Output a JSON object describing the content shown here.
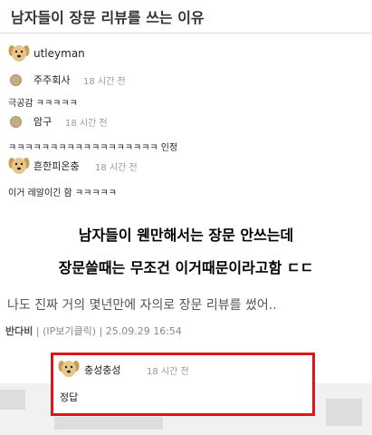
{
  "post": {
    "title": "남자들이 장문 리뷰를 쓰는 이유"
  },
  "comments": [
    {
      "user": "utleyman",
      "time": "",
      "text": ""
    },
    {
      "user": "주주회사",
      "time": "18 시간 전",
      "text": "극공감 ㅋㅋㅋㅋㅋ"
    },
    {
      "user": "암구",
      "time": "18 시간 전",
      "text": "ㅋㅋㅋㅋㅋㅋㅋㅋㅋㅋㅋㅋㅋㅋㅋㅋㅋㅋ 인정"
    },
    {
      "user": "흔한피온충",
      "time": "18 시간 전",
      "text": "이거 레알이긴 함 ㅋㅋㅋㅋㅋ"
    }
  ],
  "caption": {
    "line1": "남자들이 웬만해서는 장문 안쓰는데",
    "line2": "장문쓸때는 무조건 이거때문이라고함 ㄷㄷ"
  },
  "review": {
    "text": "나도 진짜 거의 몇년만에 자의로 장문 리뷰를 썼어..",
    "author": "반다비",
    "ip": "(IP보기클릭)",
    "date": "25.09.29 16:54"
  },
  "reply": {
    "user": "충성충성",
    "time": "18 시간 전",
    "text": "정답"
  },
  "colors": {
    "highlight": "#e0141c",
    "avatar": "#e7c68c"
  },
  "icons": {
    "dog": "dog-avatar-icon",
    "dot": "user-dot-icon"
  }
}
